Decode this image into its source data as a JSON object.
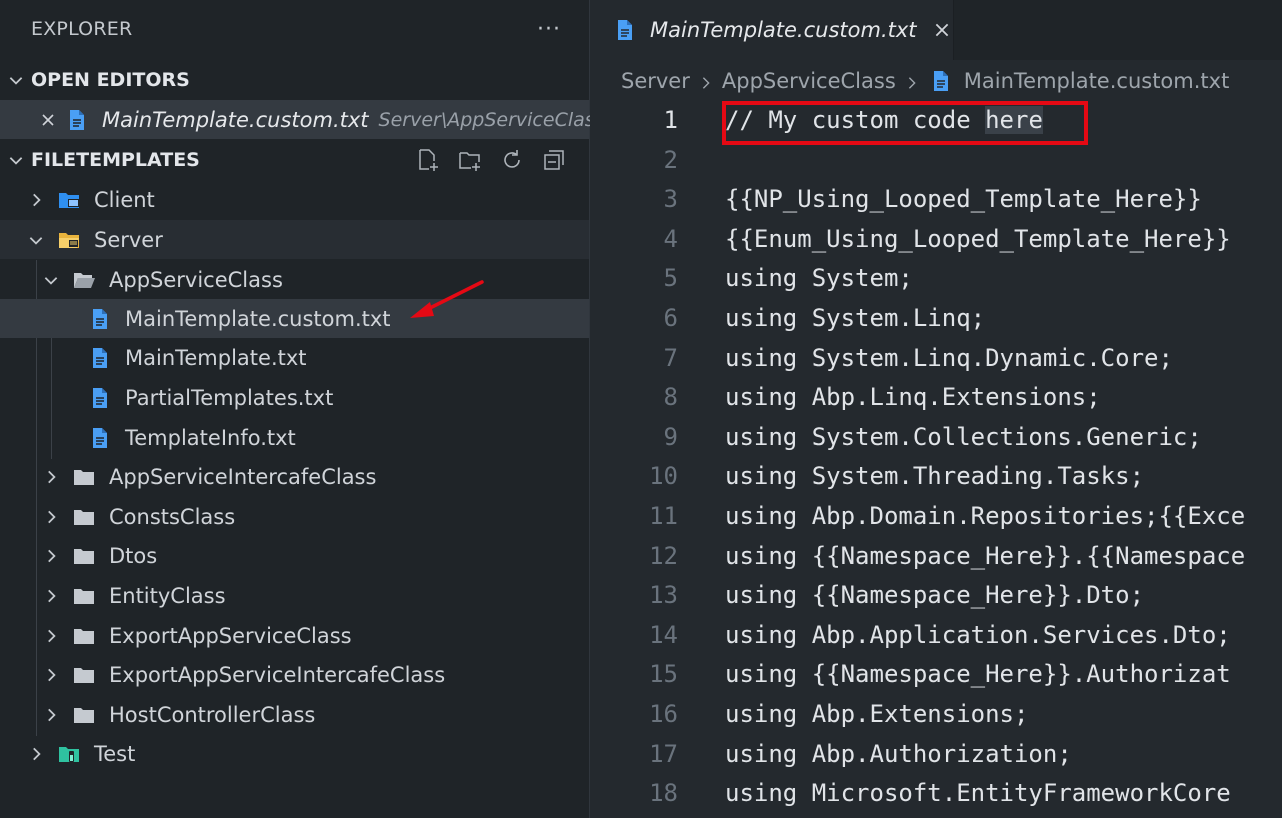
{
  "sidebar": {
    "title": "EXPLORER",
    "more_label": "···",
    "open_editors": {
      "label": "OPEN EDITORS",
      "items": [
        {
          "name": "MainTemplate.custom.txt",
          "path": "Server\\AppServiceClass"
        }
      ]
    },
    "filetemplates": {
      "label": "FILETEMPLATES",
      "tree": [
        {
          "label": "Client"
        },
        {
          "label": "Server"
        },
        {
          "label": "AppServiceClass"
        },
        {
          "label": "MainTemplate.custom.txt"
        },
        {
          "label": "MainTemplate.txt"
        },
        {
          "label": "PartialTemplates.txt"
        },
        {
          "label": "TemplateInfo.txt"
        },
        {
          "label": "AppServiceIntercafeClass"
        },
        {
          "label": "ConstsClass"
        },
        {
          "label": "Dtos"
        },
        {
          "label": "EntityClass"
        },
        {
          "label": "ExportAppServiceClass"
        },
        {
          "label": "ExportAppServiceIntercafeClass"
        },
        {
          "label": "HostControllerClass"
        },
        {
          "label": "Test"
        }
      ]
    }
  },
  "editor": {
    "tab_title": "MainTemplate.custom.txt",
    "breadcrumb": [
      "Server",
      "AppServiceClass",
      "MainTemplate.custom.txt"
    ],
    "lines": [
      {
        "n": "1",
        "text": "// My custom code ",
        "word": "here"
      },
      {
        "n": "2",
        "text": ""
      },
      {
        "n": "3",
        "text": "{{NP_Using_Looped_Template_Here}}"
      },
      {
        "n": "4",
        "text": "{{Enum_Using_Looped_Template_Here}}"
      },
      {
        "n": "5",
        "text": "using System;"
      },
      {
        "n": "6",
        "text": "using System.Linq;"
      },
      {
        "n": "7",
        "text": "using System.Linq.Dynamic.Core;"
      },
      {
        "n": "8",
        "text": "using Abp.Linq.Extensions;"
      },
      {
        "n": "9",
        "text": "using System.Collections.Generic;"
      },
      {
        "n": "10",
        "text": "using System.Threading.Tasks;"
      },
      {
        "n": "11",
        "text": "using Abp.Domain.Repositories;{{Exce"
      },
      {
        "n": "12",
        "text": "using {{Namespace_Here}}.{{Namespace"
      },
      {
        "n": "13",
        "text": "using {{Namespace_Here}}.Dto;"
      },
      {
        "n": "14",
        "text": "using Abp.Application.Services.Dto;"
      },
      {
        "n": "15",
        "text": "using {{Namespace_Here}}.Authorizat"
      },
      {
        "n": "16",
        "text": "using Abp.Extensions;"
      },
      {
        "n": "17",
        "text": "using Abp.Authorization;"
      },
      {
        "n": "18",
        "text": "using Microsoft.EntityFrameworkCore"
      }
    ]
  },
  "colors": {
    "accent_file_icon": "#4a9ff5",
    "folder_icon": "#c5cad0",
    "server_folder": "#e8b33d",
    "client_folder": "#2f8ff0",
    "test_folder": "#2fc2a0",
    "annotation_red": "#e50914"
  }
}
